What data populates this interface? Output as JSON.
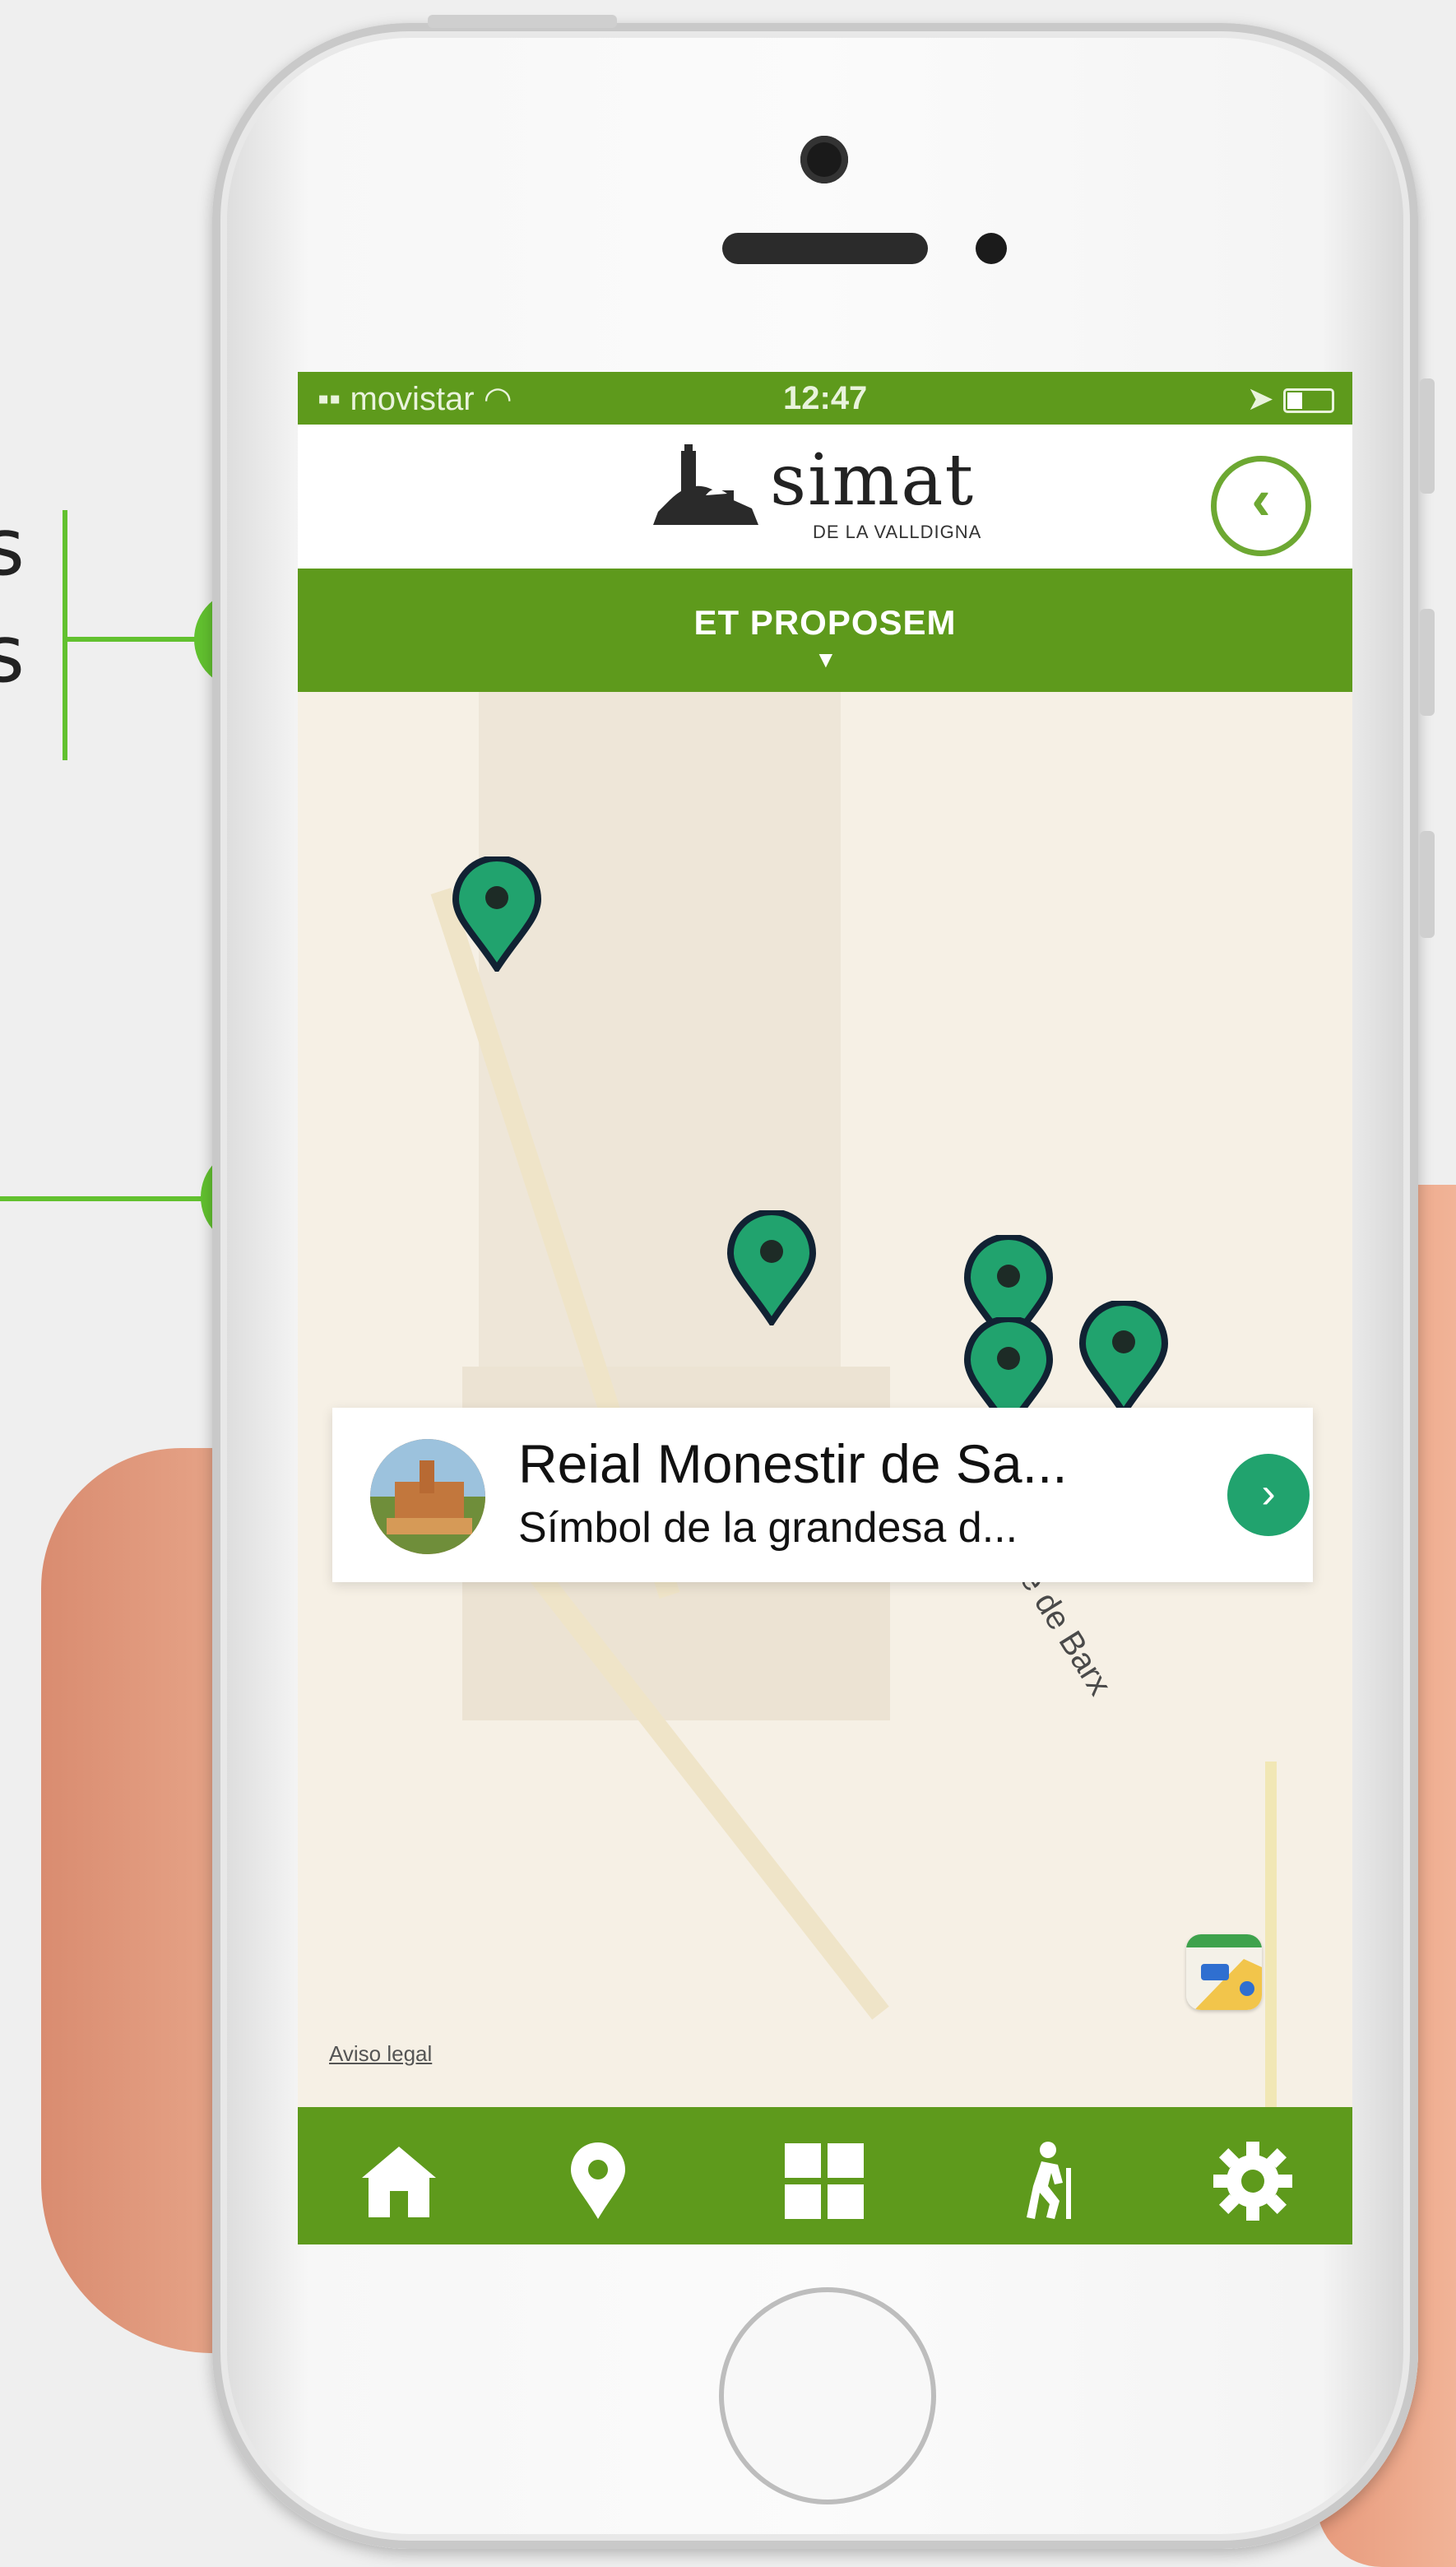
{
  "colors": {
    "brand_green": "#5e9a1c",
    "pin_green": "#21a36e",
    "callout_accent": "#62c12f"
  },
  "annotations": {
    "line1_fragment": "s",
    "line2_fragment": "s"
  },
  "status_bar": {
    "carrier": "movistar",
    "time": "12:47"
  },
  "header": {
    "logo_word": "simat",
    "logo_subtitle": "DE LA VALLDIGNA",
    "back_icon": "chevron-left-icon"
  },
  "banner": {
    "label": "ET PROPOSEM",
    "arrow": "▼"
  },
  "map": {
    "street_label": "Calle de Barx",
    "legal_link": "Aviso legal",
    "callout": {
      "title": "Reial Monestir de Sa...",
      "subtitle": "Símbol de la grandesa d...",
      "action_icon": "chevron-right-icon"
    }
  },
  "tabbar": {
    "icons": [
      "home-icon",
      "location-pin-icon",
      "grid-icon",
      "hiking-icon",
      "gear-icon"
    ]
  }
}
